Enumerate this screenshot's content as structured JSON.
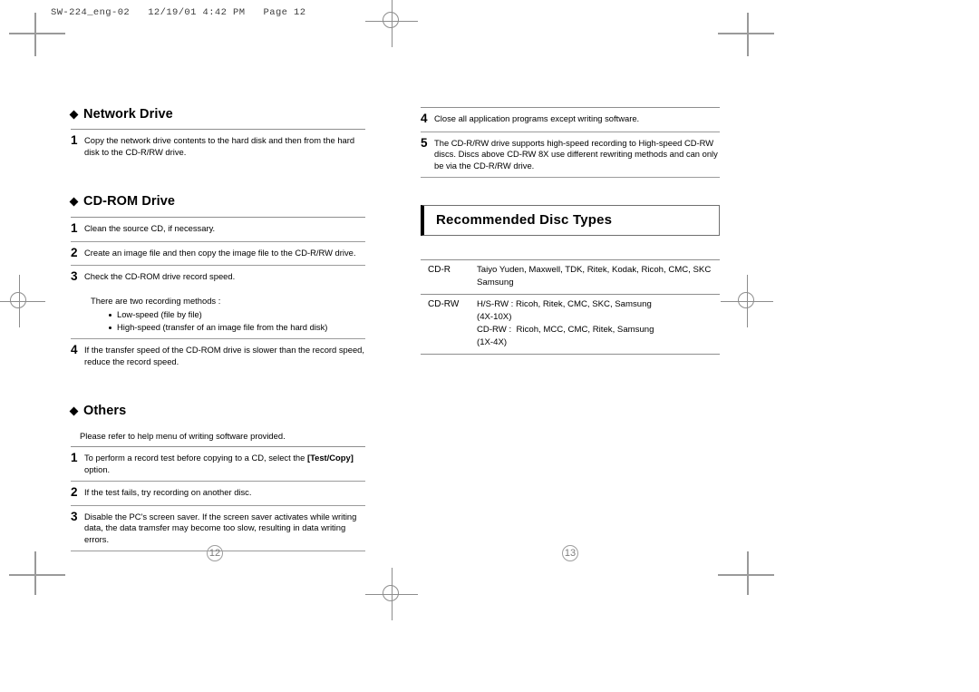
{
  "page_slug": "SW-224_eng-02   12/19/01 4:42 PM   Page 12",
  "left_column": {
    "sections": [
      {
        "heading": "Network Drive",
        "items": [
          {
            "num": "1",
            "text": "Copy the network drive contents to the hard disk and then from the hard disk to the CD-R/RW drive."
          }
        ]
      },
      {
        "heading": "CD-ROM Drive",
        "items": [
          {
            "num": "1",
            "text": "Clean the source CD, if necessary."
          },
          {
            "num": "2",
            "text": "Create an image file and then copy the image file to the CD-R/RW drive."
          },
          {
            "num": "3",
            "text": "Check the CD-ROM drive record speed."
          },
          {
            "num": "4",
            "text": "If the transfer speed of the CD-ROM drive is slower than the record speed, reduce the record speed."
          }
        ],
        "sub_note": "There are two recording methods :",
        "bullets": [
          "Low-speed (file by file)",
          "High-speed (transfer of an image file from the hard disk)"
        ]
      },
      {
        "heading": "Others",
        "note": "Please refer to help menu of writing software provided.",
        "items": [
          {
            "num": "1",
            "text_before": "To perform a record test before copying to a CD, select the ",
            "text_bold": "[Test/Copy]",
            "text_after": " option."
          },
          {
            "num": "2",
            "text": "If the test fails, try recording on another disc."
          },
          {
            "num": "3",
            "text": "Disable the PC's screen saver. If the screen saver activates while writing data, the data tramsfer may become too slow, resulting in data writing errors."
          }
        ]
      }
    ]
  },
  "right_column": {
    "items": [
      {
        "num": "4",
        "text": "Close all application programs except writing software."
      },
      {
        "num": "5",
        "text": "The CD-R/RW drive supports high-speed recording to High-speed CD-RW discs. Discs above CD-RW 8X use different rewriting methods and can only be via the CD-R/RW drive."
      }
    ],
    "title_box": "Recommended Disc Types",
    "disc_table": {
      "rows": [
        {
          "label": "CD-R",
          "lines": [
            "Taiyo Yuden, Maxwell, TDK, Ritek, Kodak, Ricoh, CMC, SKC",
            "Samsung"
          ]
        },
        {
          "label": "CD-RW",
          "lines": [
            "H/S-RW : Ricoh, Ritek, CMC, SKC, Samsung",
            "(4X-10X)",
            "CD-RW :  Ricoh, MCC, CMC, Ritek, Samsung",
            "(1X-4X)"
          ]
        }
      ]
    }
  },
  "page_numbers": {
    "left": "12",
    "right": "13"
  }
}
